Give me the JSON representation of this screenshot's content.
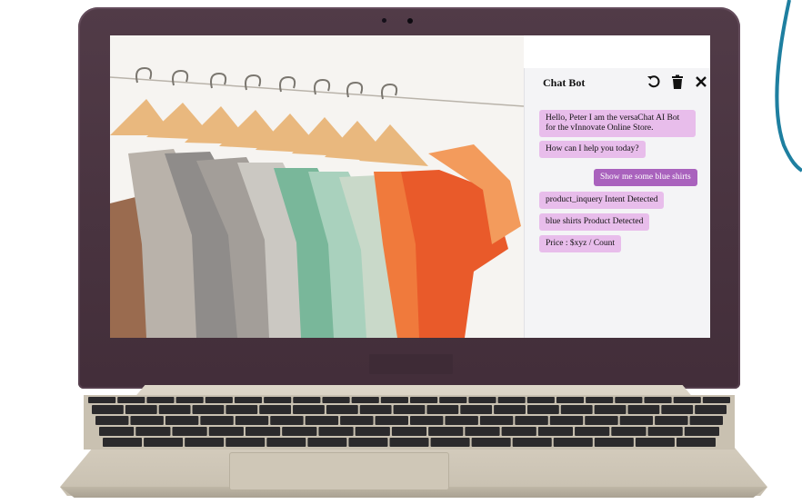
{
  "chat": {
    "title": "Chat Bot",
    "header_icons": [
      "refresh-icon",
      "trash-icon",
      "close-icon"
    ],
    "messages": [
      {
        "role": "bot",
        "text": "Hello, Peter I am the versaChat AI Bot\nfor the vInnovate Online Store."
      },
      {
        "role": "bot",
        "text": "How can I help you today?"
      },
      {
        "role": "user",
        "text": "Show me some blue shirts"
      },
      {
        "role": "bot",
        "text": "product_inquery Intent Detected"
      },
      {
        "role": "bot",
        "text": "blue shirts Product Detected"
      },
      {
        "role": "bot",
        "text": "Price : $xyz / Count"
      }
    ]
  },
  "colors": {
    "bot_bubble": "#e8bdeb",
    "user_bubble": "#a962bd",
    "laptop_lid": "#4a3340",
    "accent_arc": "#1e7fa0"
  }
}
